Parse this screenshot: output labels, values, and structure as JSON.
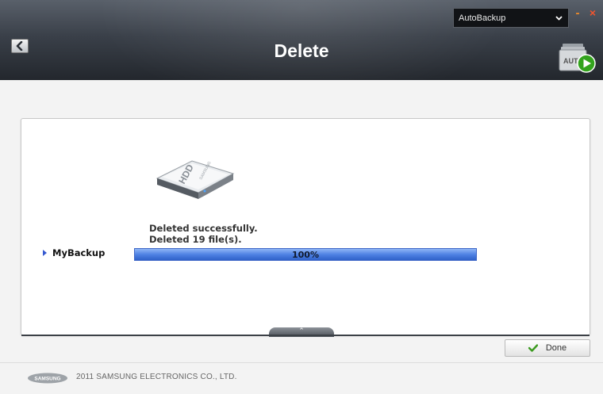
{
  "header": {
    "title": "Delete",
    "profile_select": {
      "selected": "AutoBackup"
    },
    "minimize_glyph": "-",
    "close_glyph": "×",
    "autobackup_icon_text": "AUTO"
  },
  "card": {
    "device_icon": {
      "name": "hdd-icon",
      "label": "HDD",
      "brand": "SAMSUNG"
    },
    "status_lines": [
      "Deleted successfully.",
      "Deleted 19 file(s)."
    ],
    "backup_item": {
      "name": "MyBackup"
    },
    "progress": {
      "value": 1.0,
      "label": "100%"
    }
  },
  "actions": {
    "done_label": "Done"
  },
  "footer": {
    "logo_text": "SAMSUNG",
    "copyright": "2011 SAMSUNG ELECTRONICS CO., LTD."
  },
  "colors": {
    "accent_blue": "#3f67c6",
    "done_check": "#3a9a1e",
    "play_green": "#33a31d",
    "close_orange": "#f0542e"
  }
}
